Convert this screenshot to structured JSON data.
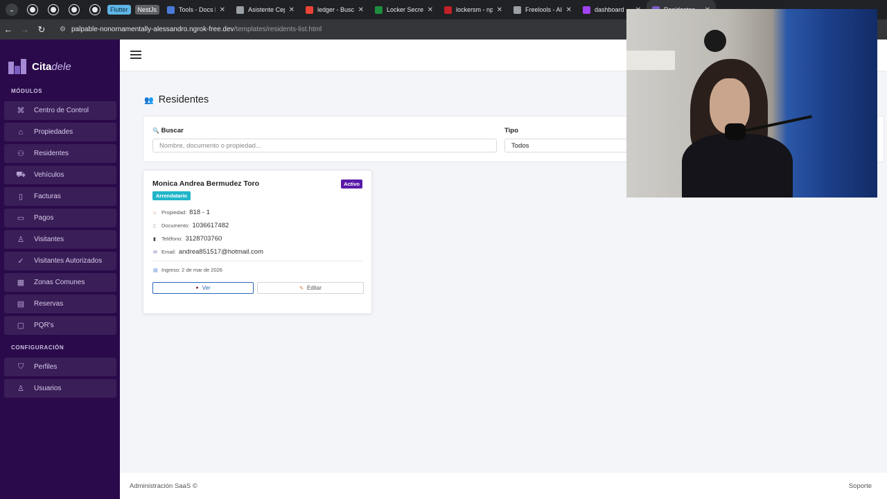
{
  "browser": {
    "tabs": [
      {
        "label": "Tools - Docs by",
        "favicon_color": "#4a7bd6",
        "active": false
      },
      {
        "label": "Asistente Cepe",
        "favicon_color": "#9aa0a6",
        "active": false
      },
      {
        "label": "ledger - Buscar",
        "favicon_color": "#ea4335",
        "active": false
      },
      {
        "label": "Locker Secrets",
        "favicon_color": "#1e8e3e",
        "active": false
      },
      {
        "label": "lockersm - npm",
        "favicon_color": "#c12127",
        "active": false
      },
      {
        "label": "Freelools - AI F",
        "favicon_color": "#9aa0a6",
        "active": false
      },
      {
        "label": "dashboard",
        "favicon_color": "#a142f4",
        "active": false
      },
      {
        "label": "Residentes",
        "favicon_color": "#7b5cc4",
        "active": true
      }
    ],
    "chips": {
      "flutter": "Flutter",
      "nestjs": "NestJs"
    },
    "url_host": "palpable-nonornamentally-alessandro.ngrok-free.dev",
    "url_path": "/templates/residents-list.html"
  },
  "brand": {
    "name_a": "Cita",
    "name_b": "dele"
  },
  "sidebar": {
    "section_modules": "MÓDULOS",
    "modules": [
      {
        "label": "Centro de Control",
        "icon": "command-icon",
        "glyph": "⌘"
      },
      {
        "label": "Propiedades",
        "icon": "home-icon",
        "glyph": "⌂"
      },
      {
        "label": "Residentes",
        "icon": "users-icon",
        "glyph": "⚇"
      },
      {
        "label": "Vehículos",
        "icon": "car-icon",
        "glyph": "⛟"
      },
      {
        "label": "Facturas",
        "icon": "file-icon",
        "glyph": "▯"
      },
      {
        "label": "Pagos",
        "icon": "credit-card-icon",
        "glyph": "▭"
      },
      {
        "label": "Visitantes",
        "icon": "user-icon",
        "glyph": "♙"
      },
      {
        "label": "Visitantes Autorizados",
        "icon": "user-check-icon",
        "glyph": "✓"
      },
      {
        "label": "Zonas Comunes",
        "icon": "grid-icon",
        "glyph": "▦"
      },
      {
        "label": "Reservas",
        "icon": "calendar-icon",
        "glyph": "▤"
      },
      {
        "label": "PQR's",
        "icon": "message-icon",
        "glyph": "▢"
      }
    ],
    "section_config": "CONFIGURACIÓN",
    "config": [
      {
        "label": "Perfiles",
        "icon": "shield-icon",
        "glyph": "⛉"
      },
      {
        "label": "Usuarios",
        "icon": "user-plus-icon",
        "glyph": "♙"
      }
    ]
  },
  "page": {
    "title": "Residentes",
    "title_icon": "👥"
  },
  "filters": {
    "search_label": "Buscar",
    "search_icon": "🔍",
    "search_placeholder": "Nombre, documento o propiedad...",
    "type_label": "Tipo",
    "type_value": "Todos"
  },
  "resident": {
    "name": "Monica Andrea Bermudez Toro",
    "status": "Activo",
    "type": "Arrendatario",
    "property_label": "Propiedad:",
    "property_value": "818 - 1",
    "document_label": "Documento:",
    "document_value": "1036617482",
    "phone_label": "Teléfono:",
    "phone_value": "3128703760",
    "email_label": "Email:",
    "email_value": "andrea851517@hotmail.com",
    "ingreso": "Ingreso: 2 de mar de 2026",
    "view_label": "Ver",
    "edit_label": "Editar"
  },
  "footer": {
    "left": "Administración SaaS ©",
    "right": "Soporte"
  },
  "colors": {
    "sidebar": "#2a0a4a",
    "status_badge": "#5a1aa8",
    "type_badge": "#21b5c9",
    "view_button": "#2a66b8"
  }
}
